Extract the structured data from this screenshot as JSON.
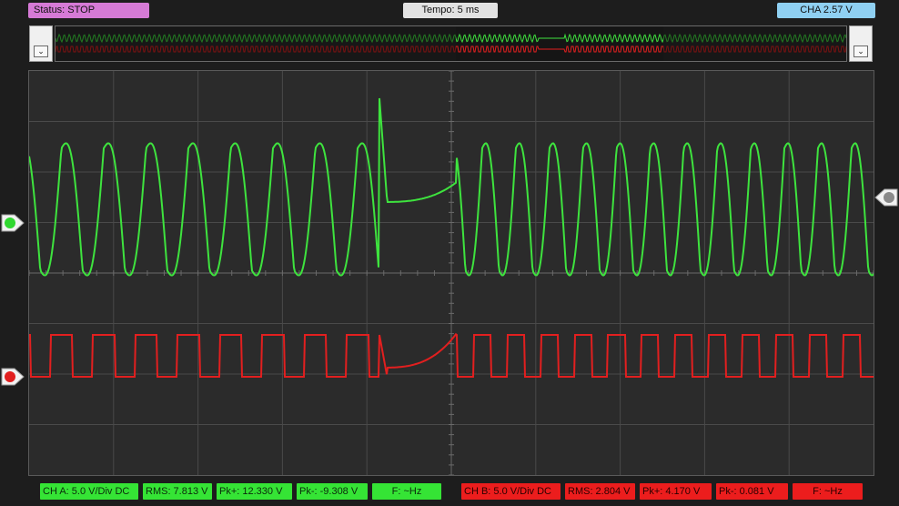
{
  "header": {
    "status": "Status: STOP",
    "timebase": "Tempo: 5 ms",
    "cha_level": "CHA 2.57 V"
  },
  "colors": {
    "ch_a": "#3ee33e",
    "ch_b": "#e21f1f",
    "status": "#d67ad6",
    "cha_badge": "#8fd0f2",
    "grid": "#4a4a4a",
    "background": "#1d1d1d"
  },
  "icons": {
    "overview_left": "chevron-down-icon",
    "overview_right": "chevron-down-icon",
    "ch_a_marker": "circle-arrow-icon",
    "ch_b_marker": "circle-arrow-icon",
    "trigger_marker": "circle-arrow-icon"
  },
  "channel_a": {
    "scale": "CH A: 5.0 V/Div DC",
    "rms": "RMS: 7.813 V",
    "pk_plus": "Pk+: 12.330 V",
    "pk_minus": "Pk-: -9.308 V",
    "freq": "F: ~Hz"
  },
  "channel_b": {
    "scale": "CH B: 5.0 V/Div DC",
    "rms": "RMS: 2.804 V",
    "pk_plus": "Pk+: 4.170 V",
    "pk_minus": "Pk-: 0.081 V",
    "freq": "F: ~Hz"
  }
}
